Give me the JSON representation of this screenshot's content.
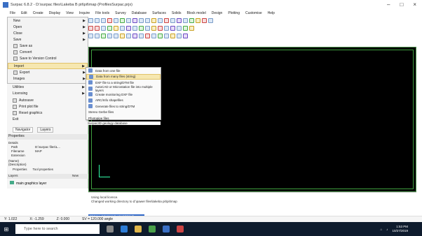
{
  "window": {
    "title": "Surpac 6.8.2 - D:\\surpac files\\Lakeba B pit\\pit\\map (ProfilesSurpac.prjx)",
    "buttons": [
      "–",
      "□",
      "×"
    ]
  },
  "menu": [
    "File",
    "Edit",
    "Create",
    "Display",
    "View",
    "Inquire",
    "File tools",
    "Survey",
    "Database",
    "Surfaces",
    "Solids",
    "Block model",
    "Design",
    "Plotting",
    "Customise",
    "Help"
  ],
  "file_menu": {
    "items": [
      {
        "label": "New",
        "arrow": true
      },
      {
        "label": "Open",
        "arrow": true
      },
      {
        "label": "Close",
        "arrow": true
      },
      {
        "label": "Save",
        "arrow": true
      },
      {
        "label": "Save as"
      },
      {
        "label": "Convert"
      },
      {
        "label": "Save to Version Control"
      },
      {
        "label": "Import",
        "arrow": true,
        "highlight": true
      },
      {
        "label": "Export",
        "arrow": true
      },
      {
        "label": "Images",
        "arrow": true
      },
      {
        "label": "Utilities",
        "arrow": true
      },
      {
        "label": "Licensing",
        "arrow": true
      },
      {
        "label": "Autosave"
      },
      {
        "label": "Print plot file"
      },
      {
        "label": "Reset graphics"
      },
      {
        "label": "Exit"
      }
    ]
  },
  "submenu": {
    "items": [
      {
        "label": "Data from one file"
      },
      {
        "label": "Data from many files (string)",
        "highlight": true
      },
      {
        "label": "DXF file to a string/DTM file"
      },
      {
        "label": "AutoCAD or Microstation file into multiple layers"
      },
      {
        "label": "Create monitoring DXF file"
      },
      {
        "label": "ARC/Info shapefiles"
      },
      {
        "label": "Generate files to string/DTM"
      },
      {
        "label": "Stereo Gerbe files"
      },
      {
        "label": "Photopipe files"
      },
      {
        "label": "Surpac3D geology database"
      }
    ]
  },
  "panels": {
    "tabs": [
      "Navigator",
      "Layers"
    ],
    "properties_title": "Properties",
    "details_title": "Details",
    "rows": [
      [
        "Path",
        "D:\\surpac files\\L..."
      ],
      [
        "Filename",
        "MAP"
      ],
      [
        "Extension",
        ""
      ]
    ],
    "name_hint": "(Name)",
    "description_hint": "(Description)",
    "prop_tabs": [
      "Properties",
      "Tool properties"
    ],
    "layers_title": "Layers",
    "layer_item": "main graphics layer",
    "new_label": "New"
  },
  "command": {
    "lines": [
      "Using local licence.",
      "Changed working directory to d:\\pawer files\\lakeba pit\\pit\\map"
    ],
    "input": "RECALL COMMAND / SHORTCUT"
  },
  "status": {
    "y": "Y: 1.022",
    "x": "X: -1.259",
    "z": "Z: 0.000",
    "bearing": "SV = 120.000 angle"
  },
  "taskbar": {
    "search": "Type here to search",
    "time": "1:53 PM",
    "date": "10/27/2019"
  }
}
